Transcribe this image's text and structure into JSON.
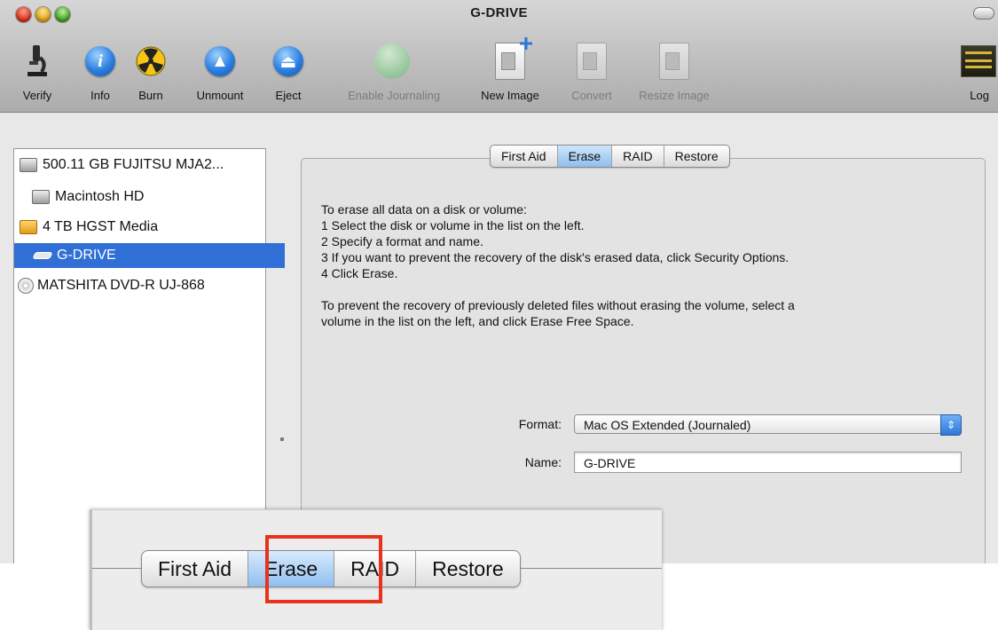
{
  "window": {
    "title": "G-DRIVE"
  },
  "toolbar": {
    "items": [
      {
        "label": "Verify",
        "icon": "microscope-icon",
        "enabled": true
      },
      {
        "label": "Info",
        "icon": "info-icon",
        "enabled": true
      },
      {
        "label": "Burn",
        "icon": "burn-icon",
        "enabled": true
      },
      {
        "label": "Unmount",
        "icon": "unmount-icon",
        "enabled": true
      },
      {
        "label": "Eject",
        "icon": "eject-icon",
        "enabled": true
      },
      {
        "label": "Enable Journaling",
        "icon": "journaling-icon",
        "enabled": false
      },
      {
        "label": "New Image",
        "icon": "new-image-icon",
        "enabled": true
      },
      {
        "label": "Convert",
        "icon": "convert-icon",
        "enabled": false
      },
      {
        "label": "Resize Image",
        "icon": "resize-image-icon",
        "enabled": false
      },
      {
        "label": "Log",
        "icon": "log-icon",
        "enabled": true
      }
    ]
  },
  "sidebar": {
    "items": [
      {
        "label": "500.11 GB FUJITSU MJA2...",
        "icon": "internal-disk-icon",
        "selected": false
      },
      {
        "label": "Macintosh HD",
        "icon": "volume-icon",
        "selected": false
      },
      {
        "label": "4 TB HGST Media",
        "icon": "external-disk-icon",
        "selected": false
      },
      {
        "label": "G-DRIVE",
        "icon": "volume-icon",
        "selected": true
      },
      {
        "label": "MATSHITA DVD-R UJ-868",
        "icon": "dvd-drive-icon",
        "selected": false
      }
    ]
  },
  "tabs": [
    {
      "label": "First Aid",
      "active": false
    },
    {
      "label": "Erase",
      "active": true
    },
    {
      "label": "RAID",
      "active": false
    },
    {
      "label": "Restore",
      "active": false
    }
  ],
  "erase": {
    "instructions": [
      "To erase all data on a disk or volume:",
      "1 Select the disk or volume in the list on the left.",
      "2 Specify a format and name.",
      "3 If you want to prevent the recovery of the disk's erased data, click Security Options.",
      "4 Click Erase."
    ],
    "free_space_line1": "To prevent the recovery of previously deleted files without erasing the volume, select a",
    "free_space_line2": "volume in the list on the left, and click Erase Free Space.",
    "format_label": "Format:",
    "format_value": "Mac OS Extended (Journaled)",
    "name_label": "Name:",
    "name_value": "G-DRIVE"
  },
  "zoom_callout": {
    "tabs": [
      {
        "label": "First Aid",
        "active": false
      },
      {
        "label": "Erase",
        "active": true
      },
      {
        "label": "RAID",
        "active": false
      },
      {
        "label": "Restore",
        "active": false
      }
    ],
    "highlight_color": "#e8321c"
  }
}
